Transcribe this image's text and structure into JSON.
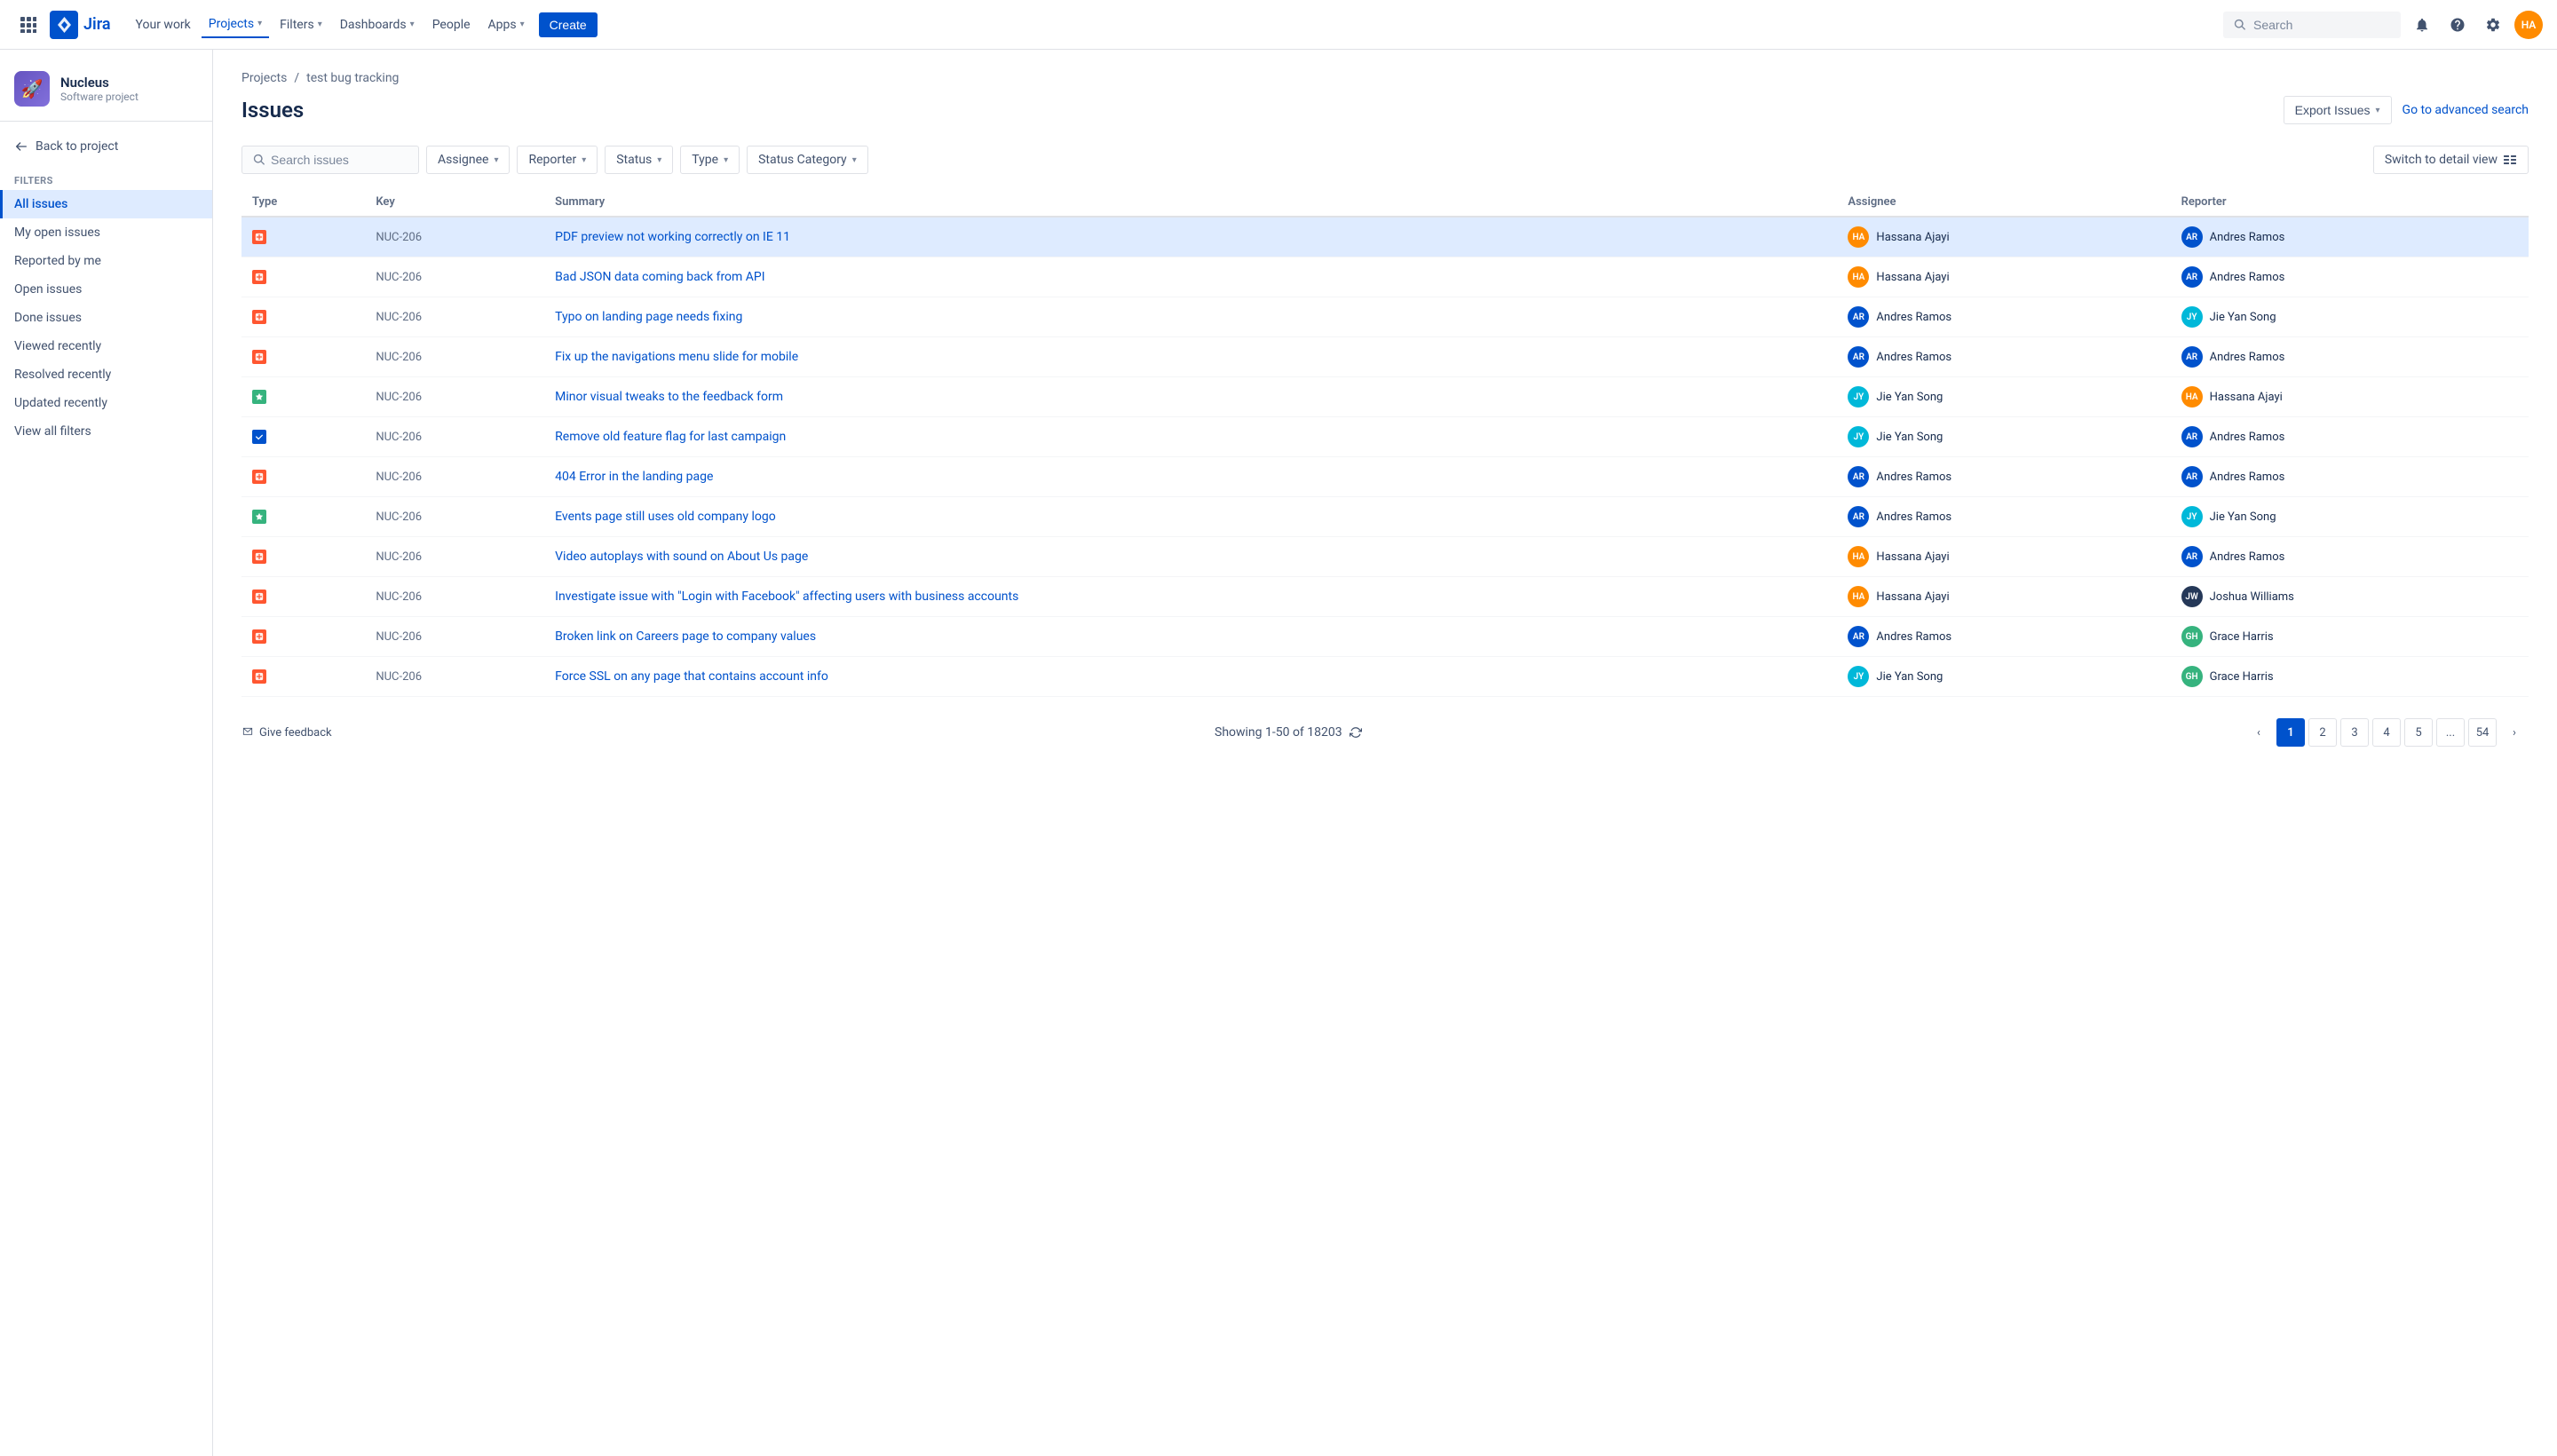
{
  "app": {
    "logo_text": "Jira"
  },
  "topnav": {
    "items": [
      {
        "id": "your-work",
        "label": "Your work"
      },
      {
        "id": "projects",
        "label": "Projects",
        "has_dropdown": true,
        "active": true
      },
      {
        "id": "filters",
        "label": "Filters",
        "has_dropdown": true
      },
      {
        "id": "dashboards",
        "label": "Dashboards",
        "has_dropdown": true
      },
      {
        "id": "people",
        "label": "People"
      },
      {
        "id": "apps",
        "label": "Apps",
        "has_dropdown": true
      }
    ],
    "create_label": "Create",
    "search_placeholder": "Search"
  },
  "sidebar": {
    "project_name": "Nucleus",
    "project_type": "Software project",
    "back_label": "Back to project",
    "section_title": "Filters",
    "items": [
      {
        "id": "all-issues",
        "label": "All issues",
        "active": true
      },
      {
        "id": "my-open-issues",
        "label": "My open issues",
        "active": false
      },
      {
        "id": "reported-by-me",
        "label": "Reported by me",
        "active": false
      },
      {
        "id": "open-issues",
        "label": "Open issues",
        "active": false
      },
      {
        "id": "done-issues",
        "label": "Done issues",
        "active": false
      },
      {
        "id": "viewed-recently",
        "label": "Viewed recently",
        "active": false
      },
      {
        "id": "resolved-recently",
        "label": "Resolved recently",
        "active": false
      },
      {
        "id": "updated-recently",
        "label": "Updated recently",
        "active": false
      },
      {
        "id": "view-all-filters",
        "label": "View all filters",
        "active": false
      }
    ]
  },
  "breadcrumb": {
    "items": [
      {
        "id": "projects",
        "label": "Projects"
      },
      {
        "id": "test-bug-tracking",
        "label": "test bug tracking"
      }
    ]
  },
  "page": {
    "title": "Issues",
    "export_label": "Export Issues",
    "adv_search_label": "Go to advanced search",
    "detail_view_label": "Switch to detail view"
  },
  "filters": {
    "search_placeholder": "Search issues",
    "assignee_label": "Assignee",
    "reporter_label": "Reporter",
    "status_label": "Status",
    "type_label": "Type",
    "status_category_label": "Status Category"
  },
  "table": {
    "columns": [
      {
        "id": "type",
        "label": "Type"
      },
      {
        "id": "key",
        "label": "Key"
      },
      {
        "id": "summary",
        "label": "Summary"
      },
      {
        "id": "assignee",
        "label": "Assignee"
      },
      {
        "id": "reporter",
        "label": "Reporter"
      }
    ],
    "rows": [
      {
        "type": "bug",
        "key": "NUC-206",
        "summary": "PDF preview not working correctly on IE 11",
        "assignee": "Hassana Ajayi",
        "assignee_av": "av-orange",
        "reporter": "Andres Ramos",
        "reporter_av": "av-blue",
        "selected": true
      },
      {
        "type": "bug",
        "key": "NUC-206",
        "summary": "Bad JSON data coming back from API",
        "assignee": "Hassana Ajayi",
        "assignee_av": "av-orange",
        "reporter": "Andres Ramos",
        "reporter_av": "av-blue",
        "selected": false
      },
      {
        "type": "bug",
        "key": "NUC-206",
        "summary": "Typo on landing page needs fixing",
        "assignee": "Andres Ramos",
        "assignee_av": "av-blue",
        "reporter": "Jie Yan Song",
        "reporter_av": "av-teal",
        "selected": false
      },
      {
        "type": "bug",
        "key": "NUC-206",
        "summary": "Fix up the navigations menu slide for mobile",
        "assignee": "Andres Ramos",
        "assignee_av": "av-blue",
        "reporter": "Andres Ramos",
        "reporter_av": "av-blue",
        "selected": false
      },
      {
        "type": "story",
        "key": "NUC-206",
        "summary": "Minor visual tweaks to the feedback form",
        "assignee": "Jie Yan Song",
        "assignee_av": "av-teal",
        "reporter": "Hassana Ajayi",
        "reporter_av": "av-orange",
        "selected": false
      },
      {
        "type": "done",
        "key": "NUC-206",
        "summary": "Remove old feature flag for last campaign",
        "assignee": "Jie Yan Song",
        "assignee_av": "av-teal",
        "reporter": "Andres Ramos",
        "reporter_av": "av-blue",
        "selected": false
      },
      {
        "type": "bug",
        "key": "NUC-206",
        "summary": "404 Error in the landing page",
        "assignee": "Andres Ramos",
        "assignee_av": "av-blue",
        "reporter": "Andres Ramos",
        "reporter_av": "av-blue",
        "selected": false
      },
      {
        "type": "story",
        "key": "NUC-206",
        "summary": "Events page still uses old company logo",
        "assignee": "Andres Ramos",
        "assignee_av": "av-blue",
        "reporter": "Jie Yan Song",
        "reporter_av": "av-teal",
        "selected": false
      },
      {
        "type": "bug",
        "key": "NUC-206",
        "summary": "Video autoplays with sound on About Us page",
        "assignee": "Hassana Ajayi",
        "assignee_av": "av-orange",
        "reporter": "Andres Ramos",
        "reporter_av": "av-blue",
        "selected": false
      },
      {
        "type": "bug",
        "key": "NUC-206",
        "summary": "Investigate issue with \"Login with Facebook\" affecting users with business accounts",
        "assignee": "Hassana Ajayi",
        "assignee_av": "av-orange",
        "reporter": "Joshua Williams",
        "reporter_av": "av-darkblue",
        "selected": false
      },
      {
        "type": "bug",
        "key": "NUC-206",
        "summary": "Broken link on Careers page to company values",
        "assignee": "Andres Ramos",
        "assignee_av": "av-blue",
        "reporter": "Grace Harris",
        "reporter_av": "av-green",
        "selected": false
      },
      {
        "type": "bug",
        "key": "NUC-206",
        "summary": "Force SSL on any page that contains account info",
        "assignee": "Jie Yan Song",
        "assignee_av": "av-teal",
        "reporter": "Grace Harris",
        "reporter_av": "av-green",
        "selected": false
      }
    ]
  },
  "pagination": {
    "showing_text": "Showing 1-50 of 18203",
    "pages": [
      "1",
      "2",
      "3",
      "4",
      "5",
      "...",
      "54"
    ],
    "current_page": "1",
    "feedback_label": "Give feedback"
  }
}
